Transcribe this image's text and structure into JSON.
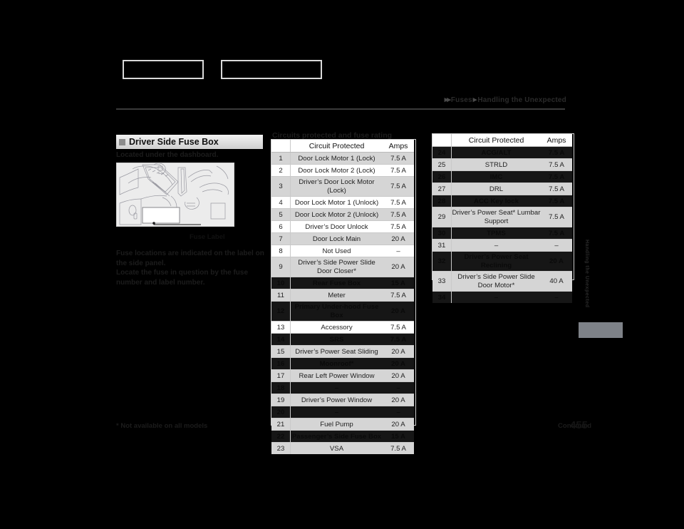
{
  "breadcrumb": {
    "text": "Fuses",
    "parent": "Handling the Unexpected"
  },
  "left": {
    "section_heading": "Driver Side Fuse Box",
    "lead": "Located under the dashboard.",
    "figure_caption": "Fuse Label",
    "body_lines": [
      "Fuse locations are indicated on the label on",
      "the side panel.",
      "Locate the fuse in question by the fuse",
      "number and label number."
    ]
  },
  "middle_table": {
    "title": "Circuits protected and fuse rating",
    "headers": [
      "",
      "Circuit Protected",
      "Amps"
    ],
    "rows": [
      {
        "no": "1",
        "circuit": "Door Lock Motor 1 (Lock)",
        "amps": "7.5 A",
        "style": "gy"
      },
      {
        "no": "2",
        "circuit": "Door Lock Motor 2 (Lock)",
        "amps": "7.5 A",
        "style": "lt"
      },
      {
        "no": "3",
        "circuit": "Driver’s Door Lock Motor (Lock)",
        "amps": "7.5 A",
        "style": "gy",
        "tall": true
      },
      {
        "no": "4",
        "circuit": "Door Lock Motor 1 (Unlock)",
        "amps": "7.5 A",
        "style": "lt"
      },
      {
        "no": "5",
        "circuit": "Door Lock Motor 2 (Unlock)",
        "amps": "7.5 A",
        "style": "gy"
      },
      {
        "no": "6",
        "circuit": "Driver’s Door Unlock",
        "amps": "7.5 A",
        "style": "lt"
      },
      {
        "no": "7",
        "circuit": "Door Lock Main",
        "amps": "20 A",
        "style": "gy"
      },
      {
        "no": "8",
        "circuit": "Not Used",
        "amps": "–",
        "style": "lt"
      },
      {
        "no": "9",
        "circuit": "Driver’s Side Power Slide Door Closer*",
        "amps": "20 A",
        "style": "gy",
        "tall": true
      },
      {
        "no": "10",
        "circuit": "Rear Fuse Box",
        "amps": "15 A",
        "style": "dk"
      },
      {
        "no": "11",
        "circuit": "Meter",
        "amps": "7.5 A",
        "style": "gy"
      },
      {
        "no": "12",
        "circuit": "Primary Under-hood Fuse Box",
        "amps": "20 A",
        "style": "dk",
        "tall": true
      },
      {
        "no": "13",
        "circuit": "Accessory",
        "amps": "7.5 A",
        "style": "lt"
      },
      {
        "no": "14",
        "circuit": "SRS",
        "amps": "7.5 A",
        "style": "dk"
      },
      {
        "no": "15",
        "circuit": "Driver’s Power Seat Sliding",
        "amps": "20 A",
        "style": "gy"
      },
      {
        "no": "16",
        "circuit": "Moonroof*",
        "amps": "20 A",
        "style": "dk"
      },
      {
        "no": "17",
        "circuit": "Rear Left Power Window",
        "amps": "20 A",
        "style": "gy"
      },
      {
        "no": "18",
        "circuit": "–",
        "amps": "–",
        "style": "dk"
      },
      {
        "no": "19",
        "circuit": "Driver’s Power Window",
        "amps": "20 A",
        "style": "gy"
      },
      {
        "no": "20",
        "circuit": "–",
        "amps": "–",
        "style": "dk"
      },
      {
        "no": "21",
        "circuit": "Fuel Pump",
        "amps": "20 A",
        "style": "gy"
      },
      {
        "no": "22",
        "circuit": "Passenger’s Side Fuse Box",
        "amps": "15 A",
        "style": "dk"
      },
      {
        "no": "23",
        "circuit": "VSA",
        "amps": "7.5 A",
        "style": "gy"
      }
    ]
  },
  "right_table": {
    "headers": [
      "",
      "Circuit Protected",
      "Amps"
    ],
    "rows": [
      {
        "no": "24",
        "circuit": "ACG/ALT",
        "amps": "7.5 A",
        "style": "dk"
      },
      {
        "no": "25",
        "circuit": "STRLD",
        "amps": "7.5 A",
        "style": "gy"
      },
      {
        "no": "26",
        "circuit": "IMC",
        "amps": "7.5 A",
        "style": "dk"
      },
      {
        "no": "27",
        "circuit": "DRL",
        "amps": "7.5 A",
        "style": "gy"
      },
      {
        "no": "28",
        "circuit": "ACC Key lock",
        "amps": "7.5 A",
        "style": "dk"
      },
      {
        "no": "29",
        "circuit": "Driver’s Power Seat* Lumbar Support",
        "amps": "7.5 A",
        "style": "gy",
        "tall": true
      },
      {
        "no": "30",
        "circuit": "TPMS",
        "amps": "7.5 A",
        "style": "dk"
      },
      {
        "no": "31",
        "circuit": "–",
        "amps": "–",
        "style": "gy"
      },
      {
        "no": "32",
        "circuit": "Driver’s Power Seat Reclining",
        "amps": "20 A",
        "style": "dk",
        "tall": true
      },
      {
        "no": "33",
        "circuit": "Driver’s Side Power Slide Door Motor*",
        "amps": "40 A",
        "style": "gy",
        "tall": true
      },
      {
        "no": "34",
        "circuit": "–",
        "amps": "–",
        "style": "dk"
      }
    ]
  },
  "footnote": "* Not available on all models",
  "footer": {
    "continued": "Continued",
    "page_number": "455"
  },
  "side_tab": {
    "label": "Handling the Unexpected"
  }
}
